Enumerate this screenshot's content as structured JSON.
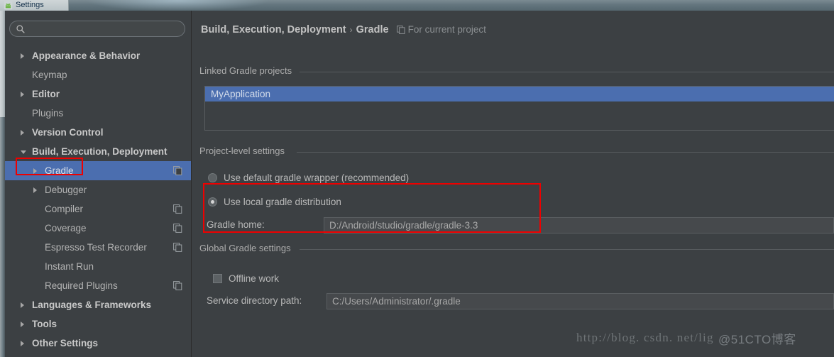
{
  "window": {
    "title": "Settings",
    "app_icon": "android-studio-icon"
  },
  "sidebar": {
    "search": {
      "value": "",
      "placeholder": "",
      "icon": "search-icon"
    },
    "items": [
      {
        "label": "Appearance & Behavior",
        "level": 0,
        "twisty": "collapsed",
        "bold": true,
        "selected": false,
        "copy_icon": false
      },
      {
        "label": "Keymap",
        "level": 0,
        "twisty": "none",
        "bold": false,
        "selected": false,
        "copy_icon": false
      },
      {
        "label": "Editor",
        "level": 0,
        "twisty": "collapsed",
        "bold": true,
        "selected": false,
        "copy_icon": false
      },
      {
        "label": "Plugins",
        "level": 0,
        "twisty": "none",
        "bold": false,
        "selected": false,
        "copy_icon": false
      },
      {
        "label": "Version Control",
        "level": 0,
        "twisty": "collapsed",
        "bold": true,
        "selected": false,
        "copy_icon": false
      },
      {
        "label": "Build, Execution, Deployment",
        "level": 0,
        "twisty": "expanded",
        "bold": true,
        "selected": false,
        "copy_icon": false
      },
      {
        "label": "Gradle",
        "level": 1,
        "twisty": "collapsed",
        "bold": false,
        "selected": true,
        "copy_icon": true
      },
      {
        "label": "Debugger",
        "level": 1,
        "twisty": "collapsed",
        "bold": false,
        "selected": false,
        "copy_icon": false
      },
      {
        "label": "Compiler",
        "level": 1,
        "twisty": "none",
        "bold": false,
        "selected": false,
        "copy_icon": true
      },
      {
        "label": "Coverage",
        "level": 1,
        "twisty": "none",
        "bold": false,
        "selected": false,
        "copy_icon": true
      },
      {
        "label": "Espresso Test Recorder",
        "level": 1,
        "twisty": "none",
        "bold": false,
        "selected": false,
        "copy_icon": true
      },
      {
        "label": "Instant Run",
        "level": 1,
        "twisty": "none",
        "bold": false,
        "selected": false,
        "copy_icon": false
      },
      {
        "label": "Required Plugins",
        "level": 1,
        "twisty": "none",
        "bold": false,
        "selected": false,
        "copy_icon": true
      },
      {
        "label": "Languages & Frameworks",
        "level": 0,
        "twisty": "collapsed",
        "bold": true,
        "selected": false,
        "copy_icon": false
      },
      {
        "label": "Tools",
        "level": 0,
        "twisty": "collapsed",
        "bold": true,
        "selected": false,
        "copy_icon": false
      },
      {
        "label": "Other Settings",
        "level": 0,
        "twisty": "collapsed",
        "bold": true,
        "selected": false,
        "copy_icon": false
      }
    ]
  },
  "main": {
    "breadcrumb": {
      "crumb1": "Build, Execution, Deployment",
      "separator": "›",
      "crumb2": "Gradle",
      "scope": "For current project",
      "scope_icon": "copy-icon"
    },
    "linked_projects": {
      "section_label": "Linked Gradle projects",
      "items": [
        {
          "label": "MyApplication",
          "selected": true
        }
      ]
    },
    "project_level": {
      "section_label": "Project-level settings",
      "radio_wrapper": {
        "label": "Use default gradle wrapper (recommended)",
        "checked": false
      },
      "radio_local": {
        "label": "Use local gradle distribution",
        "checked": true
      },
      "gradle_home": {
        "label": "Gradle home:",
        "value": "D:/Android/studio/gradle/gradle-3.3",
        "placeholder": ""
      }
    },
    "global_settings": {
      "section_label": "Global Gradle settings",
      "offline_work": {
        "label": "Offline work",
        "checked": false
      },
      "service_dir": {
        "label": "Service directory path:",
        "value": "C:/Users/Administrator/.gradle",
        "placeholder": ""
      }
    }
  },
  "watermark": {
    "url": "http://blog. csdn. net/lig",
    "overlay": "@51CTO博客"
  },
  "colors": {
    "selection_blue": "#4b6eaf",
    "annotation_red": "#ee0000",
    "panel_bg": "#3c4043",
    "field_bg": "#46494c",
    "text": "#b9b9b9"
  }
}
